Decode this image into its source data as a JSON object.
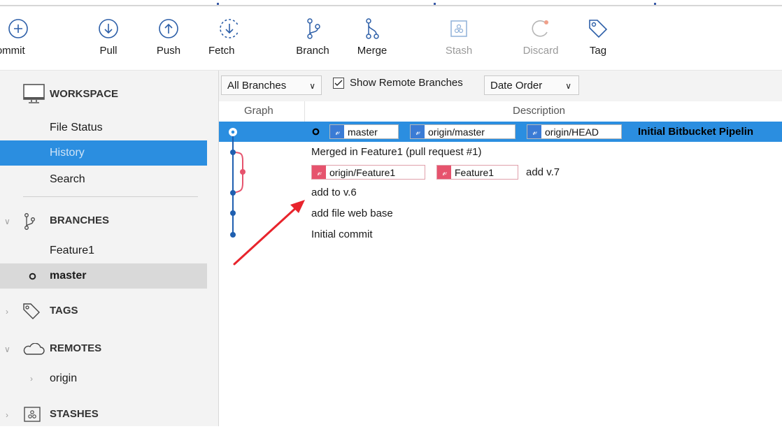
{
  "toolbar": {
    "commit": "Commit",
    "pull": "Pull",
    "push": "Push",
    "fetch": "Fetch",
    "branch": "Branch",
    "merge": "Merge",
    "stash": "Stash",
    "discard": "Discard",
    "tag": "Tag"
  },
  "sidebar": {
    "workspace": "WORKSPACE",
    "file_status": "File Status",
    "history": "History",
    "search": "Search",
    "branches": "BRANCHES",
    "feature1": "Feature1",
    "master": "master",
    "tags": "TAGS",
    "remotes": "REMOTES",
    "origin": "origin",
    "stashes": "STASHES"
  },
  "filters": {
    "branches_dropdown": "All Branches",
    "show_remote": "Show Remote Branches",
    "order_dropdown": "Date Order"
  },
  "columns": {
    "graph": "Graph",
    "description": "Description"
  },
  "commits": [
    {
      "tags": [
        "master",
        "origin/master",
        "origin/HEAD"
      ],
      "message": "Initial Bitbucket Pipelin"
    },
    {
      "message": "Merged in Feature1 (pull request #1)"
    },
    {
      "tags": [
        "origin/Feature1",
        "Feature1"
      ],
      "message": "add v.7"
    },
    {
      "message": "add to v.6"
    },
    {
      "message": "add file web base"
    },
    {
      "message": "Initial commit"
    }
  ],
  "colors": {
    "accent": "#2b8ee0",
    "graph_blue": "#1f5fb0",
    "graph_red": "#e6536d",
    "annotation_arrow": "#e8242c"
  }
}
